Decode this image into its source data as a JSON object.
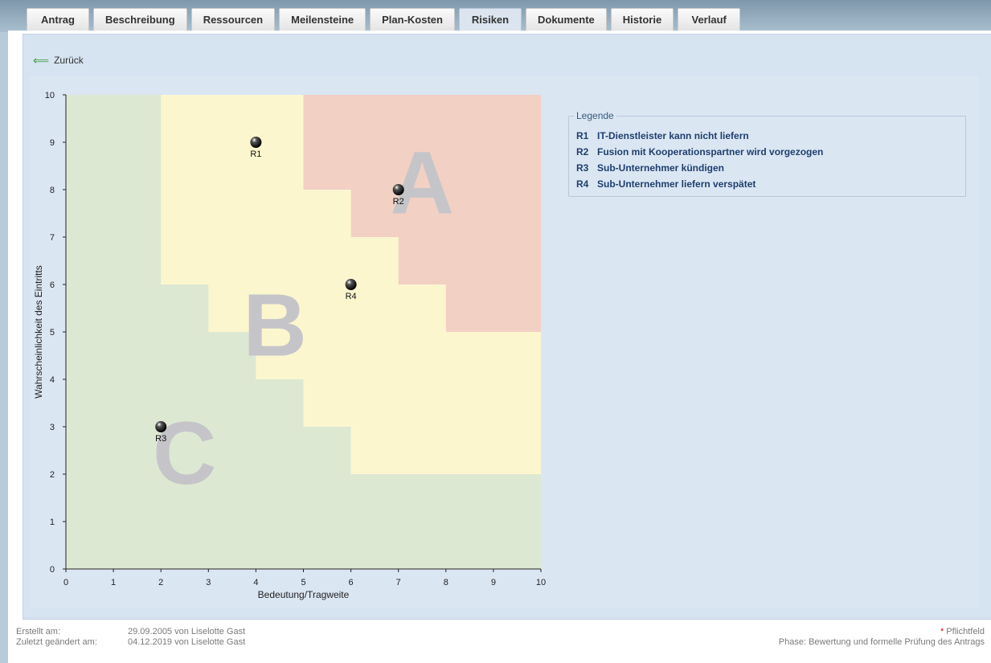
{
  "tabs": [
    {
      "label": "Antrag"
    },
    {
      "label": "Beschreibung"
    },
    {
      "label": "Ressourcen"
    },
    {
      "label": "Meilensteine"
    },
    {
      "label": "Plan-Kosten"
    },
    {
      "label": "Risiken",
      "active": true
    },
    {
      "label": "Dokumente"
    },
    {
      "label": "Historie"
    },
    {
      "label": "Verlauf"
    }
  ],
  "back_label": "Zurück",
  "chart_data": {
    "type": "scatter",
    "xlabel": "Bedeutung/Tragweite",
    "ylabel": "Wahrscheinlichkeit des Eintritts",
    "xlim": [
      0,
      10
    ],
    "ylim": [
      0,
      10
    ],
    "xticks": [
      "0",
      "1",
      "2",
      "3",
      "4",
      "5",
      "6",
      "7",
      "8",
      "9",
      "10"
    ],
    "yticks": [
      "0",
      "1",
      "2",
      "3",
      "4",
      "5",
      "6",
      "7",
      "8",
      "9",
      "10"
    ],
    "points": [
      {
        "label": "R1",
        "x": 4,
        "y": 9
      },
      {
        "label": "R2",
        "x": 7,
        "y": 8
      },
      {
        "label": "R3",
        "x": 2,
        "y": 3
      },
      {
        "label": "R4",
        "x": 6,
        "y": 6
      }
    ],
    "zones": [
      {
        "label": "A",
        "color": "#f2d0c4"
      },
      {
        "label": "B",
        "color": "#fcf6cf"
      },
      {
        "label": "C",
        "color": "#dde8d3"
      }
    ],
    "zone_boundaries": {
      "a_upper_bound_by_column": [
        10,
        10,
        10,
        10,
        10,
        8,
        7,
        6,
        5,
        5
      ],
      "b_lower_bound_by_column": [
        10,
        10,
        6,
        5,
        4,
        3,
        2,
        2,
        2,
        2
      ]
    },
    "grid": false
  },
  "legend": {
    "title": "Legende",
    "items": [
      {
        "key": "R1",
        "text": "IT-Dienstleister kann nicht liefern"
      },
      {
        "key": "R2",
        "text": "Fusion mit Kooperationspartner wird vorgezogen"
      },
      {
        "key": "R3",
        "text": "Sub-Unternehmer kündigen"
      },
      {
        "key": "R4",
        "text": "Sub-Unternehmer liefern verspätet"
      }
    ]
  },
  "footer": {
    "created_label": "Erstellt am:",
    "created_value": "29.09.2005 von Liselotte Gast",
    "modified_label": "Zuletzt geändert am:",
    "modified_value": "04.12.2019 von Liselotte Gast",
    "required_star": "*",
    "required_text": " Pflichtfeld",
    "phase": "Phase: Bewertung und formelle Prüfung des Antrags"
  }
}
